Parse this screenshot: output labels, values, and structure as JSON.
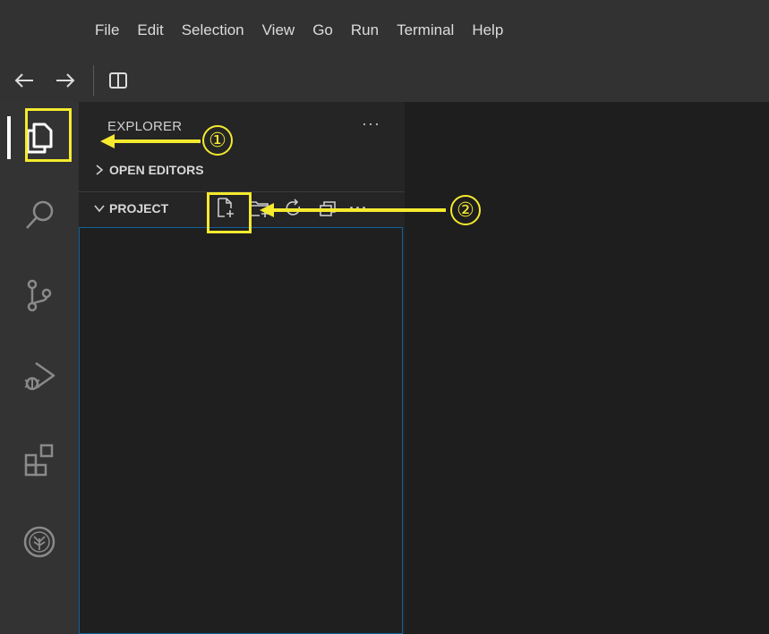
{
  "menu": [
    "File",
    "Edit",
    "Selection",
    "View",
    "Go",
    "Run",
    "Terminal",
    "Help"
  ],
  "nav": {
    "back_icon": "arrow-left-icon",
    "forward_icon": "arrow-right-icon",
    "panel_icon": "toggle-panel-icon"
  },
  "activity_bar": {
    "items": [
      "explorer",
      "search",
      "source-control",
      "run-and-debug",
      "extensions",
      "plugin"
    ]
  },
  "sidebar": {
    "title": "EXPLORER",
    "more": "···",
    "open_editors": "OPEN EDITORS",
    "project": "PROJECT",
    "project_more": "···"
  },
  "annotations": {
    "one": "①",
    "two": "②"
  },
  "colors": {
    "highlight": "#f5ea2e",
    "focus_border": "#0e639c",
    "activity_bar": "#333333",
    "sidebar": "#252526",
    "editor": "#1e1e1e"
  }
}
